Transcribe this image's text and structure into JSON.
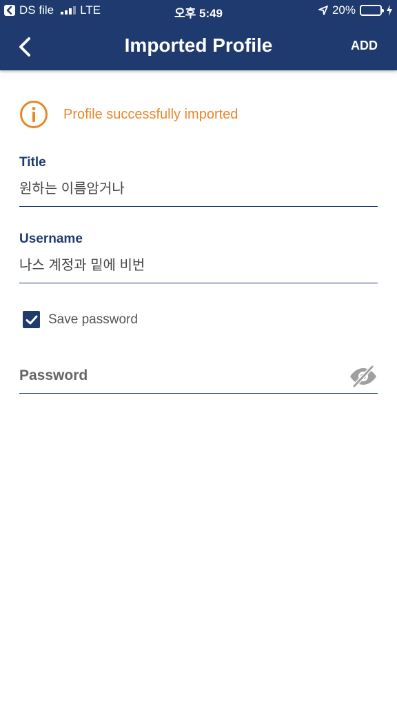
{
  "status_bar": {
    "carrier": "DS file",
    "network": "LTE",
    "time": "오후 5:49",
    "battery": "20%"
  },
  "nav": {
    "title": "Imported Profile",
    "add_label": "ADD"
  },
  "info": {
    "message": "Profile successfully imported"
  },
  "form": {
    "title_label": "Title",
    "title_value": "원하는 이름암거나",
    "username_label": "Username",
    "username_value": "나스 계정과 밑에 비번",
    "save_password_label": "Save password",
    "save_password_checked": true,
    "password_placeholder": "Password"
  },
  "colors": {
    "primary": "#1e3a6e",
    "accent": "#e8862a"
  },
  "icons": {
    "back": "chevron-left-icon",
    "info": "info-circle-icon",
    "checkbox": "checkmark-icon",
    "password_toggle": "eye-slash-icon"
  }
}
